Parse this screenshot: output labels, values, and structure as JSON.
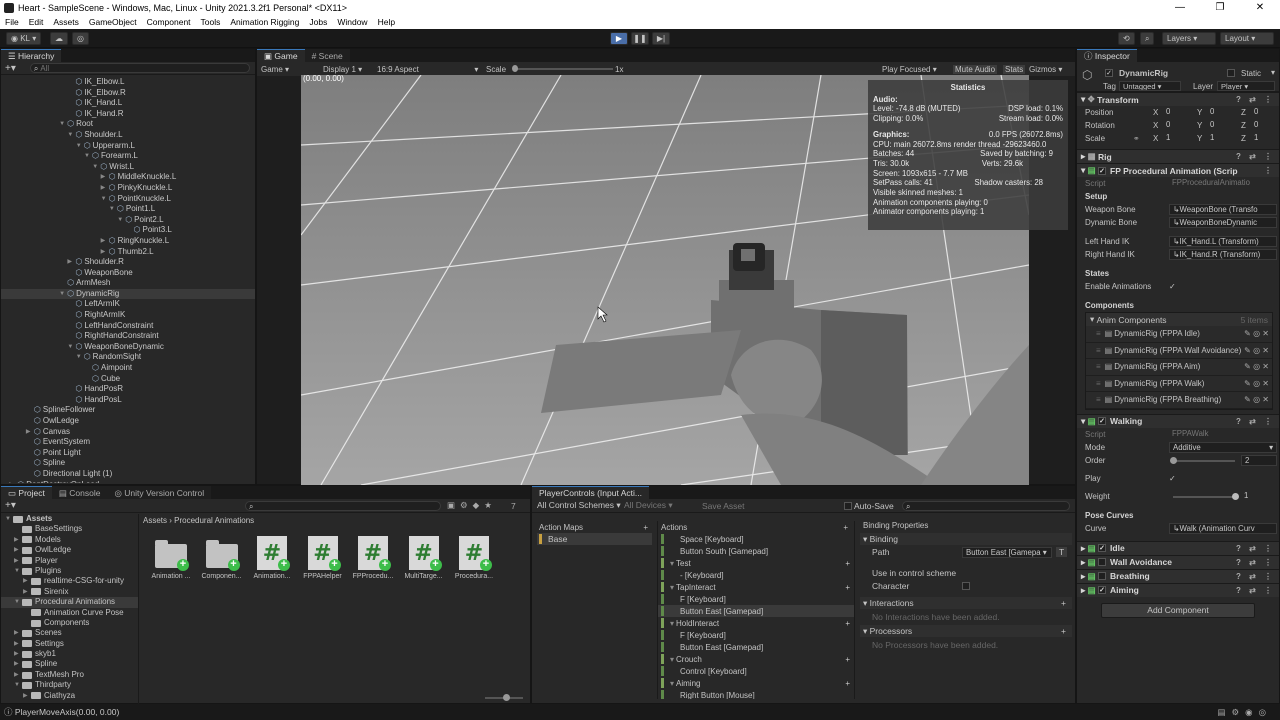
{
  "window": {
    "title": "Heart - SampleScene - Windows, Mac, Linux - Unity 2021.3.2f1 Personal* <DX11>",
    "controls": [
      "—",
      "❐",
      "✕"
    ]
  },
  "menu": [
    "File",
    "Edit",
    "Assets",
    "GameObject",
    "Component",
    "Tools",
    "Animation Rigging",
    "Jobs",
    "Window",
    "Help"
  ],
  "toolbar": {
    "account": "KL",
    "layers": "Layers",
    "layout": "Layout"
  },
  "hierarchy": {
    "tab": "Hierarchy",
    "search_placeholder": "All",
    "items": [
      {
        "label": "IK_Elbow.L",
        "depth": 8,
        "arrow": ""
      },
      {
        "label": "IK_Elbow.R",
        "depth": 8,
        "arrow": ""
      },
      {
        "label": "IK_Hand.L",
        "depth": 8,
        "arrow": ""
      },
      {
        "label": "IK_Hand.R",
        "depth": 8,
        "arrow": ""
      },
      {
        "label": "Root",
        "depth": 7,
        "arrow": "▼"
      },
      {
        "label": "Shoulder.L",
        "depth": 8,
        "arrow": "▼"
      },
      {
        "label": "Upperarm.L",
        "depth": 9,
        "arrow": "▼"
      },
      {
        "label": "Forearm.L",
        "depth": 10,
        "arrow": "▼"
      },
      {
        "label": "Wrist.L",
        "depth": 11,
        "arrow": "▼"
      },
      {
        "label": "MiddleKnuckle.L",
        "depth": 12,
        "arrow": "▶"
      },
      {
        "label": "PinkyKnuckle.L",
        "depth": 12,
        "arrow": "▶"
      },
      {
        "label": "PointKnuckle.L",
        "depth": 12,
        "arrow": "▼"
      },
      {
        "label": "Point1.L",
        "depth": 13,
        "arrow": "▼"
      },
      {
        "label": "Point2.L",
        "depth": 14,
        "arrow": "▼"
      },
      {
        "label": "Point3.L",
        "depth": 15,
        "arrow": ""
      },
      {
        "label": "RingKnuckle.L",
        "depth": 12,
        "arrow": "▶"
      },
      {
        "label": "Thumb2.L",
        "depth": 12,
        "arrow": "▶"
      },
      {
        "label": "Shoulder.R",
        "depth": 8,
        "arrow": "▶"
      },
      {
        "label": "WeaponBone",
        "depth": 8,
        "arrow": ""
      },
      {
        "label": "ArmMesh",
        "depth": 7,
        "arrow": ""
      },
      {
        "label": "DynamicRig",
        "depth": 7,
        "arrow": "▼",
        "selected": true
      },
      {
        "label": "LeftArmIK",
        "depth": 8,
        "arrow": ""
      },
      {
        "label": "RightArmIK",
        "depth": 8,
        "arrow": ""
      },
      {
        "label": "LeftHandConstraint",
        "depth": 8,
        "arrow": ""
      },
      {
        "label": "RightHandConstraint",
        "depth": 8,
        "arrow": ""
      },
      {
        "label": "WeaponBoneDynamic",
        "depth": 8,
        "arrow": "▼"
      },
      {
        "label": "RandomSight",
        "depth": 9,
        "arrow": "▼"
      },
      {
        "label": "Aimpoint",
        "depth": 10,
        "arrow": ""
      },
      {
        "label": "Cube",
        "depth": 10,
        "arrow": ""
      },
      {
        "label": "HandPosR",
        "depth": 8,
        "arrow": ""
      },
      {
        "label": "HandPosL",
        "depth": 8,
        "arrow": ""
      },
      {
        "label": "SplineFollower",
        "depth": 3,
        "arrow": ""
      },
      {
        "label": "OwlLedge",
        "depth": 3,
        "arrow": ""
      },
      {
        "label": "Canvas",
        "depth": 3,
        "arrow": "▶"
      },
      {
        "label": "EventSystem",
        "depth": 3,
        "arrow": ""
      },
      {
        "label": "Point Light",
        "depth": 3,
        "arrow": ""
      },
      {
        "label": "Spline",
        "depth": 3,
        "arrow": ""
      },
      {
        "label": "Directional Light (1)",
        "depth": 3,
        "arrow": ""
      },
      {
        "label": "DontDestroyOnLoad",
        "depth": 1,
        "arrow": "▶"
      }
    ]
  },
  "game": {
    "tab_game": "Game",
    "tab_scene": "Scene",
    "mode": "Game",
    "display": "Display 1",
    "aspect": "16:9 Aspect",
    "scale_label": "Scale",
    "scale_value": "1x",
    "play_focused": "Play Focused",
    "mute": "Mute Audio",
    "stats": "Stats",
    "gizmos": "Gizmos",
    "coords": "(0.00, 0.00)",
    "stats_panel": {
      "title": "Statistics",
      "audio_head": "Audio:",
      "level": "Level: -74.8 dB (MUTED)",
      "dsp": "DSP load: 0.1%",
      "clipping": "Clipping: 0.0%",
      "stream": "Stream load: 0.0%",
      "graphics_head": "Graphics:",
      "fps": "0.0 FPS (26072.8ms)",
      "cpu": "CPU: main 26072.8ms  render thread -29623460.0",
      "batches": "Batches: 44",
      "saved": "Saved by batching: 9",
      "tris": "Tris: 30.0k",
      "verts": "Verts: 29.6k",
      "screen": "Screen: 1093x615 - 7.7 MB",
      "setpass": "SetPass calls: 41",
      "shadow": "Shadow casters: 28",
      "skinned": "Visible skinned meshes: 1",
      "anim_comp": "Animation components playing: 0",
      "animator_comp": "Animator components playing: 1"
    }
  },
  "inspector": {
    "tab": "Inspector",
    "object_name": "DynamicRig",
    "static_label": "Static",
    "tag_label": "Tag",
    "tag_value": "Untagged",
    "layer_label": "Layer",
    "layer_value": "Player",
    "transform": {
      "title": "Transform",
      "position": "Position",
      "rotation": "Rotation",
      "scale": "Scale",
      "pos": [
        "0",
        "0",
        "0"
      ],
      "rot": [
        "0",
        "0",
        "0"
      ],
      "scl": [
        "1",
        "1",
        "1"
      ],
      "axes": [
        "X",
        "Y",
        "Z"
      ]
    },
    "rig_title": "Rig",
    "fp": {
      "title": "FP Procedural Animation (Scrip",
      "script_label": "Script",
      "script_value": "FPProceduralAnimatio",
      "setup": "Setup",
      "weapon_bone": "Weapon Bone",
      "weapon_bone_value": "WeaponBone (Transfo",
      "dynamic_bone": "Dynamic Bone",
      "dynamic_bone_value": "WeaponBoneDynamic",
      "left_ik": "Left Hand IK",
      "left_ik_value": "IK_Hand.L (Transform)",
      "right_ik": "Right Hand IK",
      "right_ik_value": "IK_Hand.R (Transform)",
      "states": "States",
      "enable_anim": "Enable Animations",
      "components": "Components",
      "anim_components": "Anim Components",
      "anim_count": "5 items",
      "anim_items": [
        "DynamicRig (FPPA Idle)",
        "DynamicRig (FPPA Wall Avoidance)",
        "DynamicRig (FPPA Aim)",
        "DynamicRig (FPPA Walk)",
        "DynamicRig (FPPA Breathing)"
      ]
    },
    "walking": {
      "title": "Walking",
      "script_label": "Script",
      "script_value": "FPPAWalk",
      "mode_label": "Mode",
      "mode_value": "Additive",
      "order_label": "Order",
      "order_value": "2",
      "play_label": "Play",
      "weight_label": "Weight",
      "weight_value": "1",
      "pose_curves": "Pose Curves",
      "curve_label": "Curve",
      "curve_value": "Walk (Animation Curv"
    },
    "collapsed": [
      "Idle",
      "Wall Avoidance",
      "Breathing",
      "Aiming"
    ],
    "add_component": "Add Component"
  },
  "project": {
    "tab_project": "Project",
    "tab_console": "Console",
    "tab_vc": "Unity Version Control",
    "breadcrumb_root": "Assets",
    "breadcrumb_leaf": "Procedural Animations",
    "hidden_count": "7",
    "tree": [
      {
        "label": "Assets",
        "depth": 0,
        "arrow": "▼",
        "bold": true
      },
      {
        "label": "BaseSettings",
        "depth": 1,
        "arrow": ""
      },
      {
        "label": "Models",
        "depth": 1,
        "arrow": "▶"
      },
      {
        "label": "OwlLedge",
        "depth": 1,
        "arrow": "▶"
      },
      {
        "label": "Player",
        "depth": 1,
        "arrow": "▶"
      },
      {
        "label": "Plugins",
        "depth": 1,
        "arrow": "▼"
      },
      {
        "label": "realtime-CSG-for-unity",
        "depth": 2,
        "arrow": "▶"
      },
      {
        "label": "Sirenix",
        "depth": 2,
        "arrow": "▶"
      },
      {
        "label": "Procedural Animations",
        "depth": 1,
        "arrow": "▼",
        "selected": true
      },
      {
        "label": "Animation Curve Pose",
        "depth": 2,
        "arrow": ""
      },
      {
        "label": "Components",
        "depth": 2,
        "arrow": ""
      },
      {
        "label": "Scenes",
        "depth": 1,
        "arrow": "▶"
      },
      {
        "label": "Settings",
        "depth": 1,
        "arrow": "▶"
      },
      {
        "label": "skyb1",
        "depth": 1,
        "arrow": "▶"
      },
      {
        "label": "Spline",
        "depth": 1,
        "arrow": "▶"
      },
      {
        "label": "TextMesh Pro",
        "depth": 1,
        "arrow": "▶"
      },
      {
        "label": "Thirdparty",
        "depth": 1,
        "arrow": "▼"
      },
      {
        "label": "Ciathyza",
        "depth": 2,
        "arrow": "▶"
      }
    ],
    "assets": [
      {
        "label": "Animation ...",
        "type": "folder"
      },
      {
        "label": "Componen...",
        "type": "folder"
      },
      {
        "label": "Animation...",
        "type": "script"
      },
      {
        "label": "FPPAHelper",
        "type": "script"
      },
      {
        "label": "FPProcedu...",
        "type": "script"
      },
      {
        "label": "MultiTarge...",
        "type": "script"
      },
      {
        "label": "Procedura...",
        "type": "script"
      }
    ]
  },
  "input_actions": {
    "tab": "PlayerControls (Input Acti...",
    "schemes": "All Control Schemes",
    "devices": "All Devices",
    "save": "Save Asset",
    "autosave": "Auto-Save",
    "maps_head": "Action Maps",
    "maps": [
      "Base"
    ],
    "actions_head": "Actions",
    "actions": [
      {
        "label": "Space [Keyboard]",
        "kind": "binding"
      },
      {
        "label": "Button South [Gamepad]",
        "kind": "binding"
      },
      {
        "label": "Test",
        "kind": "action"
      },
      {
        "label": "- [Keyboard]",
        "kind": "binding"
      },
      {
        "label": "TapInteract",
        "kind": "action"
      },
      {
        "label": "F [Keyboard]",
        "kind": "binding"
      },
      {
        "label": "Button East [Gamepad]",
        "kind": "binding",
        "selected": true
      },
      {
        "label": "HoldInteract",
        "kind": "action"
      },
      {
        "label": "F [Keyboard]",
        "kind": "binding"
      },
      {
        "label": "Button East [Gamepad]",
        "kind": "binding"
      },
      {
        "label": "Crouch",
        "kind": "action"
      },
      {
        "label": "Control [Keyboard]",
        "kind": "binding"
      },
      {
        "label": "Aiming",
        "kind": "action"
      },
      {
        "label": "Right Button [Mouse]",
        "kind": "binding"
      }
    ],
    "props_head": "Binding Properties",
    "binding": "Binding",
    "path_label": "Path",
    "path_value": "Button East [Gamepa",
    "path_t": "T",
    "use_in_scheme": "Use in control scheme",
    "character": "Character",
    "interactions": "Interactions",
    "no_interactions": "No Interactions have been added.",
    "processors": "Processors",
    "no_processors": "No Processors have been added."
  },
  "status": {
    "text": "PlayerMoveAxis(0.00, 0.00)"
  }
}
